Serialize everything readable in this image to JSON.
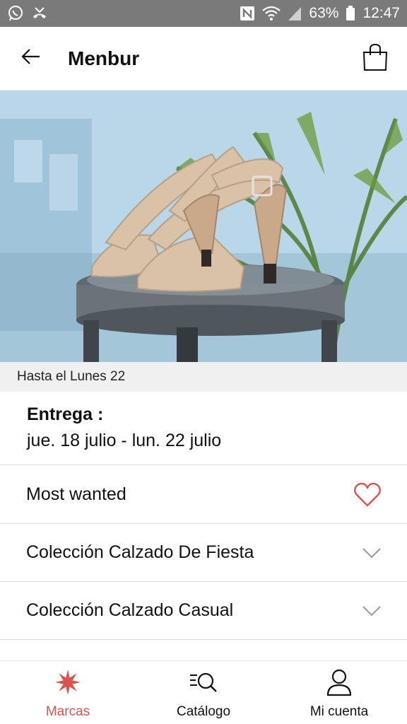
{
  "status_bar": {
    "battery": "63%",
    "time": "12:47",
    "left_icons": [
      "whatsapp-icon",
      "missed-call-icon"
    ],
    "right_icons": [
      "nfc-icon",
      "wifi-icon",
      "signal-icon",
      "battery-icon"
    ]
  },
  "app_bar": {
    "title": "Menbur",
    "back_icon": "arrow-left-icon",
    "bag_icon": "shopping-bag-icon"
  },
  "hero": {
    "alt_icon": "product-photo"
  },
  "delivery": {
    "deadline": "Hasta el Lunes 22",
    "label": "Entrega :",
    "dates": "jue. 18 julio - lun. 22 julio"
  },
  "rows": [
    {
      "label": "Most wanted",
      "icon": "heart-icon"
    },
    {
      "label": "Colección Calzado De Fiesta",
      "icon": "chevron-down-icon"
    },
    {
      "label": "Colección Calzado Casual",
      "icon": "chevron-down-icon"
    }
  ],
  "bottom_nav": {
    "items": [
      {
        "label": "Marcas",
        "icon": "flower-icon",
        "active": true
      },
      {
        "label": "Catálogo",
        "icon": "search-list-icon",
        "active": false
      },
      {
        "label": "Mi cuenta",
        "icon": "user-icon",
        "active": false
      }
    ]
  },
  "colors": {
    "accent": "#d9534f",
    "status_bar": "#7a7a7a"
  }
}
